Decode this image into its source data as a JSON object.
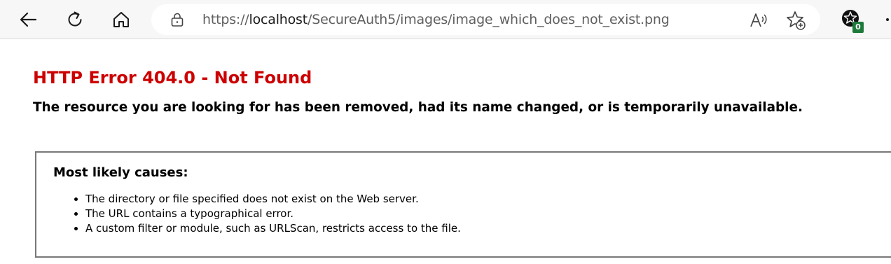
{
  "browser": {
    "url": {
      "scheme": "https://",
      "host": "localhost",
      "path": "/SecureAuth5/images/image_which_does_not_exist.png"
    },
    "extension_badge": "0",
    "icons": [
      "back-arrow-icon",
      "refresh-icon",
      "home-icon",
      "lock-icon",
      "read-aloud-icon",
      "add-favorite-icon",
      "extension-icon",
      "more-icon"
    ]
  },
  "page": {
    "title": "HTTP Error 404.0 - Not Found",
    "subtitle": "The resource you are looking for has been removed, had its name changed, or is temporarily unavailable.",
    "causes": {
      "heading": "Most likely causes:",
      "items": [
        "The directory or file specified does not exist on the Web server.",
        "The URL contains a typographical error.",
        "A custom filter or module, such as URLScan, restricts access to the file."
      ]
    }
  },
  "colors": {
    "error_title": "#cc0000",
    "toolbar_bg": "#f7f7f7",
    "box_border": "#787878",
    "badge_bg": "#1e7a3a"
  }
}
